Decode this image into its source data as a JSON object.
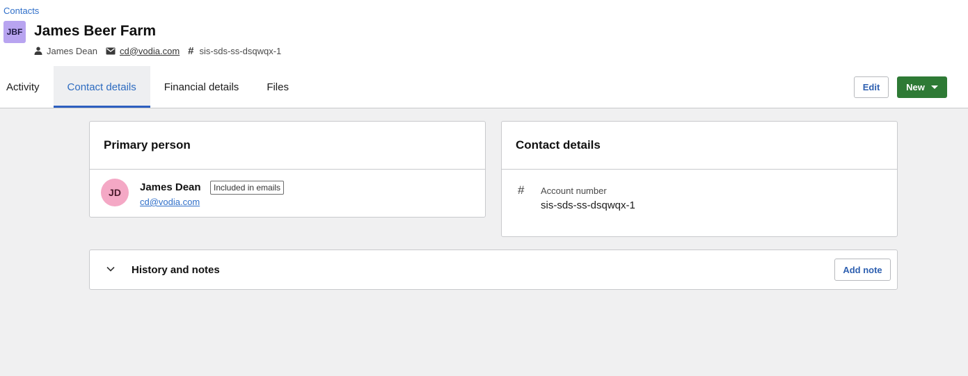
{
  "breadcrumb": {
    "label": "Contacts"
  },
  "contact": {
    "initials": "JBF",
    "name": "James Beer Farm",
    "person": "James Dean",
    "email": "cd@vodia.com",
    "account": "sis-sds-ss-dsqwqx-1",
    "avatar_color": "#b8a4f0"
  },
  "tabs": [
    {
      "label": "Activity",
      "active": false
    },
    {
      "label": "Contact details",
      "active": true
    },
    {
      "label": "Financial details",
      "active": false
    },
    {
      "label": "Files",
      "active": false
    }
  ],
  "actions": {
    "edit_label": "Edit",
    "new_label": "New",
    "new_color": "#2e7a35"
  },
  "primary_person": {
    "title": "Primary person",
    "initials": "JD",
    "name": "James Dean",
    "badge": "Included in emails",
    "email": "cd@vodia.com",
    "avatar_color": "#f4a8c5"
  },
  "contact_details": {
    "title": "Contact details",
    "account_label": "Account number",
    "account_value": "sis-sds-ss-dsqwqx-1"
  },
  "history": {
    "title": "History and notes",
    "add_note_label": "Add note"
  },
  "icons": [
    "person-icon",
    "mail-icon",
    "hash-icon",
    "chevron-down-icon",
    "caret-down-icon"
  ]
}
